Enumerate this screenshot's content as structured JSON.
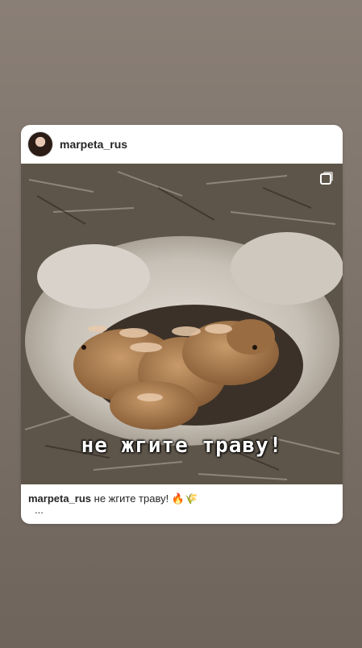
{
  "post": {
    "username": "marpeta_rus",
    "overlay_text": "не жгите траву!",
    "caption_user": "marpeta_rus",
    "caption_text": " не жгите траву! 🔥🌾",
    "more": "..."
  },
  "icons": {
    "avatar": "profile-photo",
    "multi": "multiple-posts-icon"
  },
  "colors": {
    "background": "#857a71",
    "card": "#ffffff"
  }
}
